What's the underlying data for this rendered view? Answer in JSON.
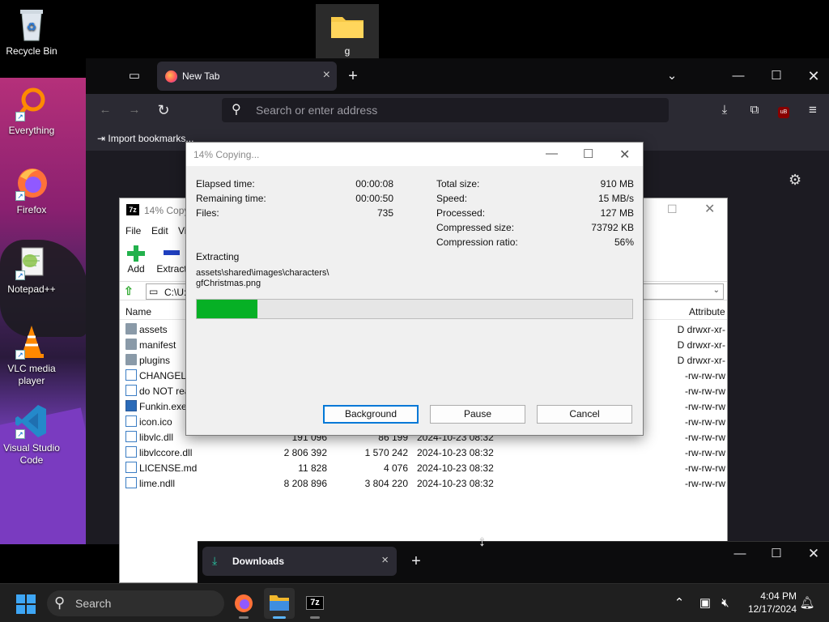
{
  "desktop": {
    "icons": [
      {
        "label": "Recycle Bin"
      },
      {
        "label": "Everything"
      },
      {
        "label": "Firefox"
      },
      {
        "label": "Notepad++"
      },
      {
        "label": "VLC media player"
      },
      {
        "label": "Visual Studio Code"
      }
    ],
    "folder_label": "g"
  },
  "firefox": {
    "tab_title": "New Tab",
    "url_placeholder": "Search or enter address",
    "bookmark_label": "Import bookmarks..."
  },
  "zip_manager": {
    "title": "14% Copy",
    "menu": [
      "File",
      "Edit",
      "Vi"
    ],
    "toolbar": {
      "add": "Add",
      "extract": "Extract"
    },
    "path": "C:\\U:",
    "columns": {
      "name": "Name",
      "attributes": "Attribute"
    },
    "rows": [
      {
        "name": "assets",
        "kind": "folder",
        "size": "",
        "packed": "",
        "modified": "",
        "attr": "D drwxr-xr-"
      },
      {
        "name": "manifest",
        "kind": "folder",
        "size": "",
        "packed": "",
        "modified": "",
        "attr": "D drwxr-xr-"
      },
      {
        "name": "plugins",
        "kind": "folder",
        "size": "",
        "packed": "",
        "modified": "",
        "attr": "D drwxr-xr-"
      },
      {
        "name": "CHANGELO",
        "kind": "file",
        "size": "",
        "packed": "",
        "modified": "",
        "attr": "-rw-rw-rw"
      },
      {
        "name": "do NOT rea",
        "kind": "file",
        "size": "",
        "packed": "",
        "modified": "",
        "attr": "-rw-rw-rw"
      },
      {
        "name": "Funkin.exe",
        "kind": "exe",
        "size": "",
        "packed": "",
        "modified": "",
        "attr": "-rw-rw-rw"
      },
      {
        "name": "icon.ico",
        "kind": "ico",
        "size": "",
        "packed": "",
        "modified": "",
        "attr": "-rw-rw-rw"
      },
      {
        "name": "libvlc.dll",
        "kind": "file",
        "size": "191 096",
        "packed": "86 199",
        "modified": "2024-10-23 08:32",
        "attr": "-rw-rw-rw"
      },
      {
        "name": "libvlccore.dll",
        "kind": "file",
        "size": "2 806 392",
        "packed": "1 570 242",
        "modified": "2024-10-23 08:32",
        "attr": "-rw-rw-rw"
      },
      {
        "name": "LICENSE.md",
        "kind": "file",
        "size": "11 828",
        "packed": "4 076",
        "modified": "2024-10-23 08:32",
        "attr": "-rw-rw-rw"
      },
      {
        "name": "lime.ndll",
        "kind": "file",
        "size": "8 208 896",
        "packed": "3 804 220",
        "modified": "2024-10-23 08:32",
        "attr": "-rw-rw-rw"
      }
    ]
  },
  "copy_dialog": {
    "title": "14% Copying...",
    "left_stats": [
      {
        "label": "Elapsed time:",
        "value": "00:00:08"
      },
      {
        "label": "Remaining time:",
        "value": "00:00:50"
      },
      {
        "label": "Files:",
        "value": "735"
      }
    ],
    "right_stats": [
      {
        "label": "Total size:",
        "value": "910 MB"
      },
      {
        "label": "Speed:",
        "value": "15 MB/s"
      },
      {
        "label": "Processed:",
        "value": "127 MB"
      },
      {
        "label": "Compressed size:",
        "value": "73792 KB"
      },
      {
        "label": "Compression ratio:",
        "value": "56%"
      }
    ],
    "operation": "Extracting",
    "current_path_line1": "assets\\shared\\images\\characters\\",
    "current_path_line2": "gfChristmas.png",
    "progress_percent": 14,
    "buttons": {
      "background": "Background",
      "pause": "Pause",
      "cancel": "Cancel"
    }
  },
  "downloads": {
    "tab_title": "Downloads"
  },
  "taskbar": {
    "search_label": "Search",
    "time": "4:04 PM",
    "date": "12/17/2024"
  }
}
